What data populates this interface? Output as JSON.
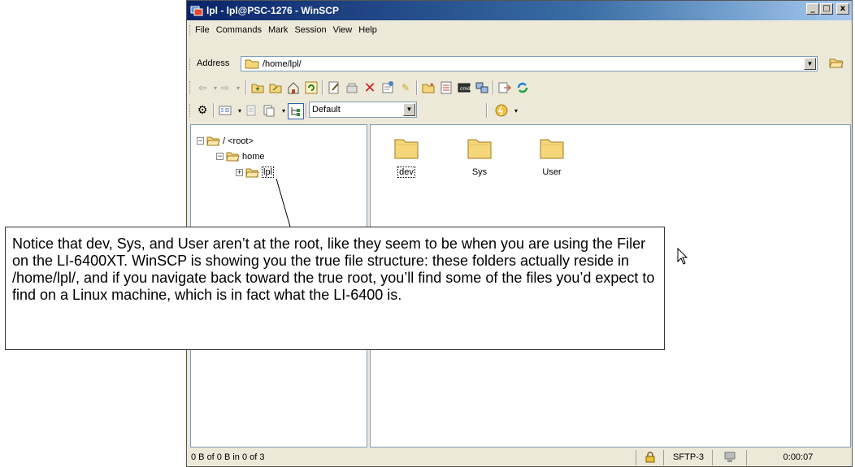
{
  "window": {
    "title": "lpl - lpl@PSC-1276 - WinSCP",
    "min_label": "_",
    "max_label": "□",
    "close_label": "x"
  },
  "menu": [
    "File",
    "Commands",
    "Mark",
    "Session",
    "View",
    "Help"
  ],
  "address": {
    "label": "Address",
    "value": "/home/lpl/"
  },
  "toolbar2": {
    "profile_select": "Default"
  },
  "tree": {
    "root_label": "/ <root>",
    "home_label": "home",
    "lpl_label": "lpl"
  },
  "files": [
    {
      "name": "dev"
    },
    {
      "name": "Sys"
    },
    {
      "name": "User"
    }
  ],
  "status": {
    "summary": "0 B of 0 B in 0 of 3",
    "protocol": "SFTP-3",
    "elapsed": "0:00:07"
  },
  "callout": {
    "text": "Notice that dev, Sys, and User aren’t at the root, like they seem to be when you are using the Filer on the LI-6400XT. WinSCP is showing you the true file structure: these folders actually reside in /home/lpl/, and if you navigate back toward the true root, you’ll find some of the files you’d expect to find on a Linux machine, which is in fact what the LI-6400 is."
  },
  "colors": {
    "folder": "#f5d77a",
    "titlebar": "#0a246a",
    "chrome": "#ece9d8"
  }
}
